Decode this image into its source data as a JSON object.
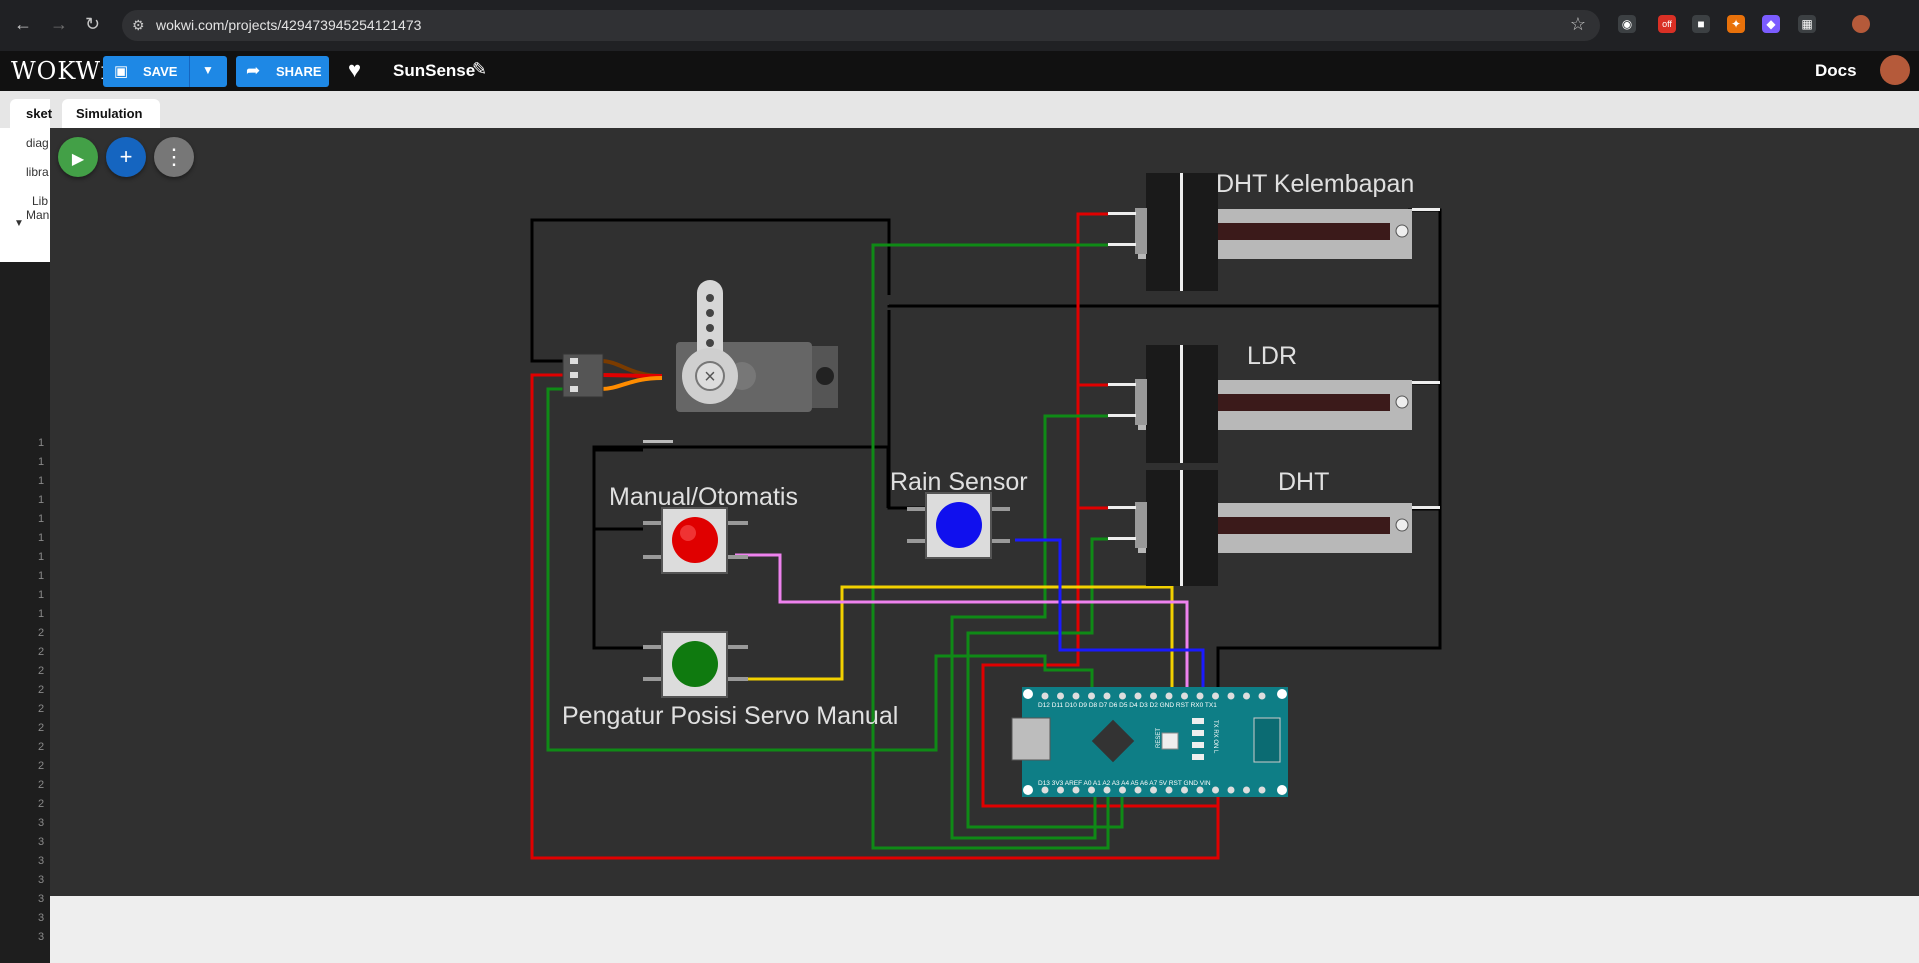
{
  "browser": {
    "url": "wokwi.com/projects/429473945254121473",
    "back_icon": "arrow-left-icon",
    "forward_icon": "arrow-right-icon",
    "reload_icon": "reload-icon",
    "star_icon": "star-icon",
    "extension_badge": "off"
  },
  "app": {
    "logo": "WOKWi",
    "save_label": "SAVE",
    "share_label": "SHARE",
    "project_name": "SunSense",
    "docs_label": "Docs"
  },
  "editor": {
    "tabs": [
      {
        "label": "sket"
      },
      {
        "label": "Simulation"
      }
    ],
    "files": [
      "diag",
      "libra",
      "Lib",
      "Man"
    ]
  },
  "line_numbers": [
    "1",
    "1",
    "1",
    "1",
    "1",
    "1",
    "1",
    "1",
    "1",
    "1",
    "2",
    "2",
    "2",
    "2",
    "2",
    "2",
    "2",
    "2",
    "2",
    "2",
    "3",
    "3",
    "3",
    "3",
    "3",
    "3",
    "3"
  ],
  "simulation": {
    "labels": {
      "dht_kelembapan": "DHT Kelembapan",
      "ldr": "LDR",
      "dht": "DHT",
      "rain_sensor": "Rain Sensor",
      "manual_otomatis": "Manual/Otomatis",
      "servo_manual": "Pengatur Posisi Servo Manual"
    },
    "arduino_top_pins": "D12 D11 D10 D9 D8 D7 D6 D5 D4 D3 D2 GND RST RX0 TX1",
    "arduino_bottom_pins": "D13 3V3 AREF A0 A1 A2 A3 A4 A5 A6 A7 5V RST GND VIN",
    "reset_label": "RESET",
    "led_labels": "TX RX ON L",
    "colors": {
      "wire_red": "#e00000",
      "wire_green": "#0f8a16",
      "wire_black": "#000000",
      "wire_yellow": "#f2d100",
      "wire_blue": "#1a1aff",
      "wire_pink": "#ee82ee",
      "arduino": "#0e7e86"
    }
  }
}
